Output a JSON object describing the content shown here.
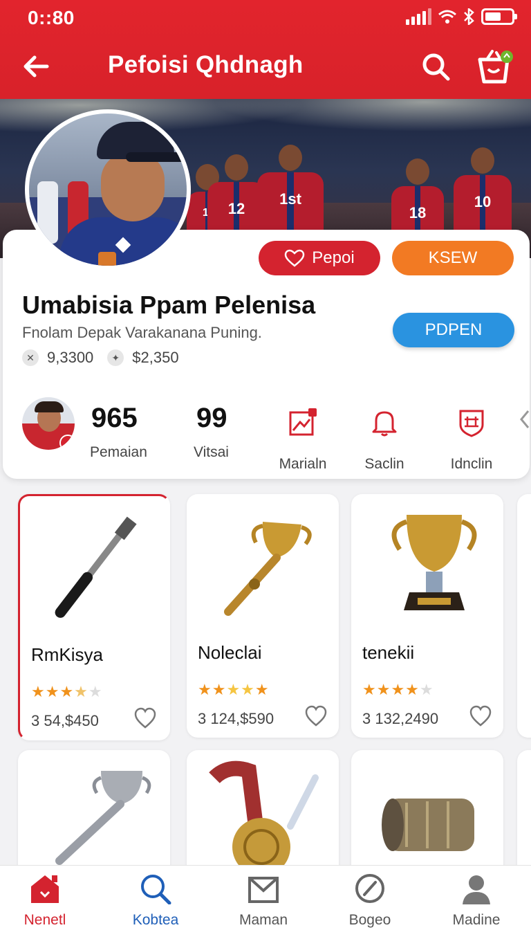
{
  "status_bar": {
    "time": "0::80"
  },
  "app_bar": {
    "title": "Pefoisi Qhdnagh"
  },
  "profile": {
    "name": "Umabisia Ppam Pelenisa",
    "subtitle": "Fnolam Depak Varakanana Puning.",
    "meta_1": "9,3300",
    "meta_2": "$2,350",
    "buttons": {
      "pepoi": "Pepoi",
      "ksew": "KSEW",
      "pdpen": "PDPEN"
    },
    "banner_jerseys": [
      "1st",
      "12",
      "18",
      "10"
    ]
  },
  "stats": [
    {
      "value": "965",
      "label": "Pemaian"
    },
    {
      "value": "99",
      "label": "Vitsai"
    }
  ],
  "tools": [
    "Marialn",
    "Saclin",
    "Idnclin"
  ],
  "products": [
    {
      "name": "RmKisya",
      "rating": 3.5,
      "price": "3 54,$450",
      "selected": true
    },
    {
      "name": "Noleclai",
      "rating": 5,
      "price": "3 124,$590",
      "selected": false
    },
    {
      "name": "tenekii",
      "rating": 4.5,
      "price": "3 132,2490",
      "selected": false
    }
  ],
  "nav": [
    "Nenetl",
    "Kobtea",
    "Maman",
    "Bogeo",
    "Madine"
  ],
  "colors": {
    "brand_red": "#d4232f",
    "orange": "#f27a23",
    "blue": "#2a93e0",
    "star": "#f0921c"
  }
}
